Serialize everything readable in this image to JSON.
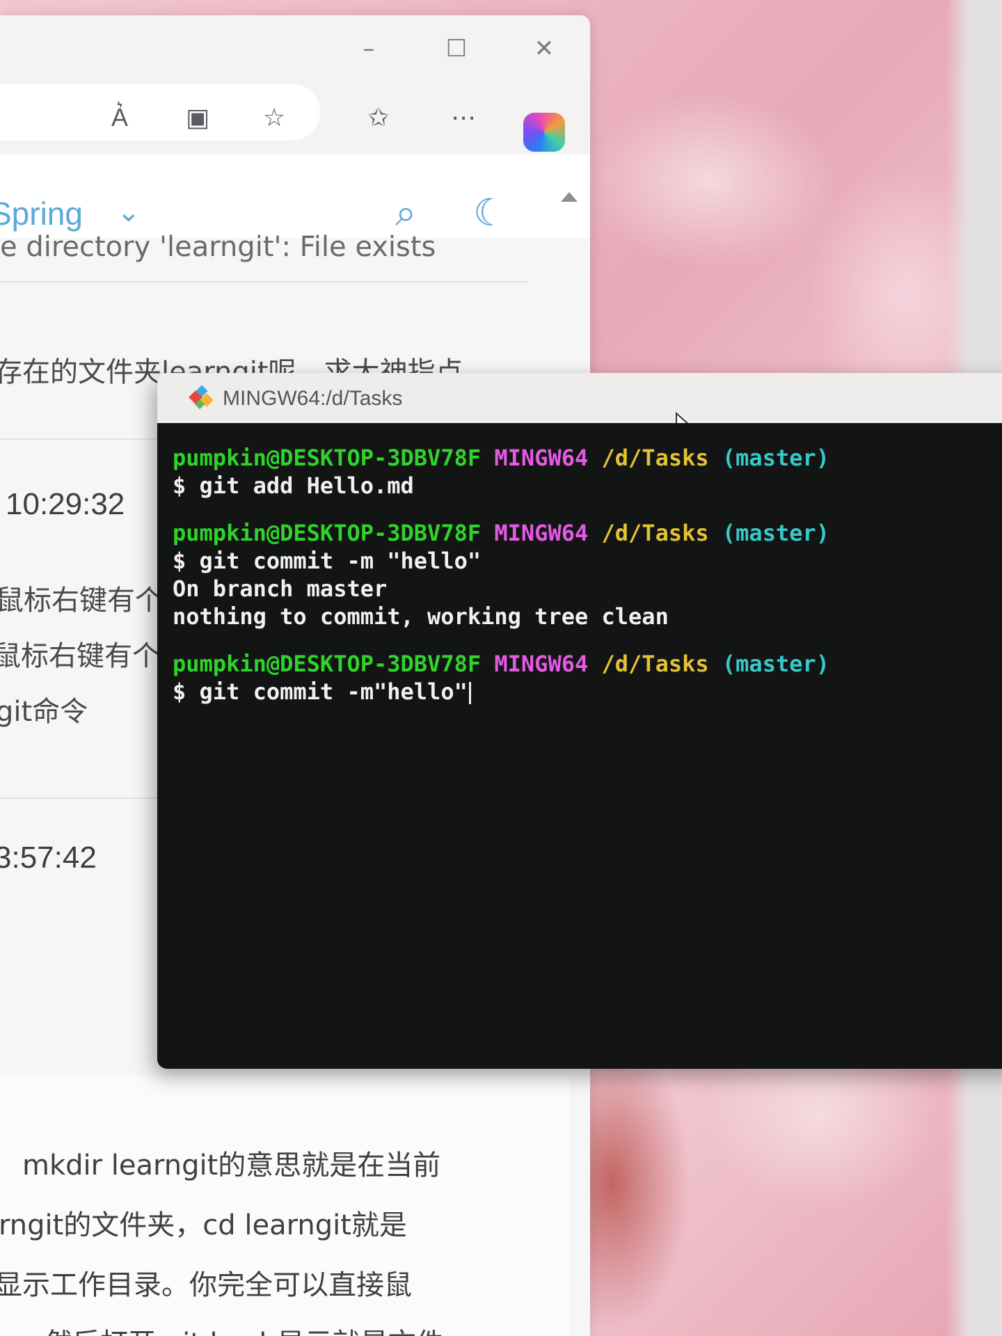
{
  "browser": {
    "toolbar": {
      "icons": [
        "read-aloud-icon",
        "immersive-reader-icon",
        "favorite-star-icon",
        "favorites-list-icon",
        "more-icon",
        "copilot-icon"
      ]
    },
    "site": {
      "brand": "Spring",
      "header_icons": [
        "search-icon",
        "dark-mode-icon"
      ]
    },
    "content": {
      "cut_line": "e directory 'learngit': File exists",
      "question": "存在的文件夹learngit呢，求大神指点",
      "answers": [
        {
          "timestamp": "10:29:32",
          "lines": [
            "鼠标右键有个",
            "鼠标右键有个",
            "git命令"
          ]
        },
        {
          "timestamp": "3:57:42"
        }
      ],
      "reply_lines": [
        "mkdir learngit的意思就是在当前",
        "rngit的文件夹，cd learngit就是",
        "显示工作目录。你完全可以直接鼠",
        "然后打开 git bash显示就是文件"
      ]
    }
  },
  "terminal": {
    "title": "MINGW64:/d/Tasks",
    "blocks": [
      {
        "prompt": {
          "user": "pumpkin@DESKTOP-3DBV78F",
          "system": "MINGW64",
          "path": "/d/Tasks",
          "branch": "(master)"
        },
        "command": "$ git add Hello.md",
        "output": []
      },
      {
        "prompt": {
          "user": "pumpkin@DESKTOP-3DBV78F",
          "system": "MINGW64",
          "path": "/d/Tasks",
          "branch": "(master)"
        },
        "command": "$ git commit -m \"hello\"",
        "output": [
          "On branch master",
          "nothing to commit, working tree clean"
        ]
      },
      {
        "prompt": {
          "user": "pumpkin@DESKTOP-3DBV78F",
          "system": "MINGW64",
          "path": "/d/Tasks",
          "branch": "(master)"
        },
        "command": "$ git commit -m\"hello\"",
        "output": []
      }
    ]
  }
}
